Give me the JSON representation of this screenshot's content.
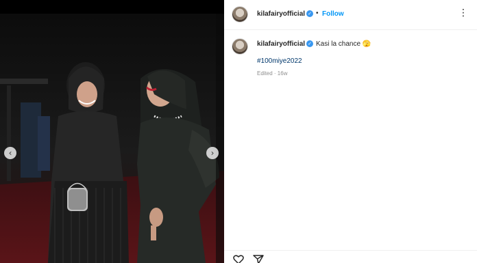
{
  "post": {
    "username": "kilafairyofficial",
    "verified_badge": "✓",
    "separator": "•",
    "follow_label": "Follow",
    "more_label": "⋮",
    "caption_text": "Kasi la chance 🫣",
    "hashtag": "#100miye2022",
    "meta": "Edited · 16w"
  },
  "media": {
    "prev_label": "‹",
    "next_label": "›"
  },
  "icons": {
    "prev": "chevron-left-icon",
    "next": "chevron-right-icon",
    "like": "heart-icon",
    "share": "paper-plane-icon",
    "verified": "verified-badge-icon",
    "more": "more-options-icon"
  },
  "colors": {
    "accent": "#0095f6",
    "verified": "#3897f0",
    "hashtag": "#00376b",
    "muted": "#8e8e8e"
  }
}
